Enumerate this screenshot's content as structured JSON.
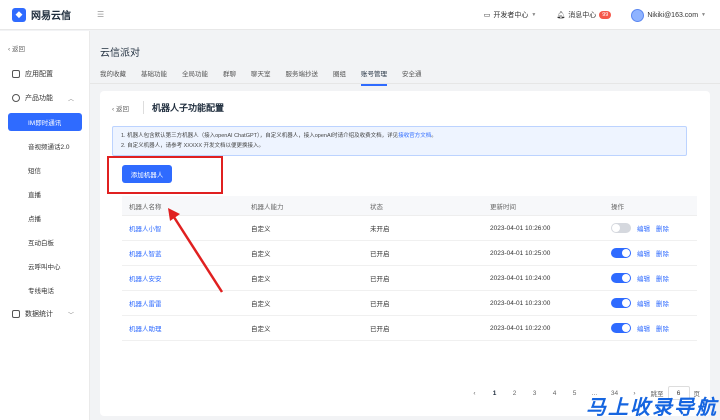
{
  "app": {
    "logo_text": "网易云信",
    "collapse_icon": "menu-collapse-icon"
  },
  "topbar": {
    "developer_center": "开发者中心",
    "messages": "消息中心",
    "message_badge": "99",
    "user_email": "Nikiki@163.com"
  },
  "sidebar": {
    "back": "返回",
    "items": [
      {
        "label": "应用配置",
        "icon": "app-settings-icon"
      },
      {
        "label": "产品功能",
        "icon": "product-icon"
      }
    ],
    "sub_items": [
      "IM即时通讯",
      "音视频通话2.0",
      "短信",
      "直播",
      "点播",
      "互动白板",
      "云呼叫中心",
      "专线电话"
    ],
    "stats": {
      "label": "数据统计",
      "icon": "monitor-icon"
    }
  },
  "main": {
    "title": "云信派对",
    "tabs": [
      "我的收藏",
      "基础功能",
      "全局功能",
      "群聊",
      "聊天室",
      "服务端抄送",
      "圈组",
      "账号管理",
      "安全通"
    ],
    "active_tab": "账号管理"
  },
  "card": {
    "back": "返回",
    "title": "机器人子功能配置",
    "notice_line1": "1. 机器人包含默认第三方机器人（接入openAI ChatGPT），自定义机器人，接入openAI时请介绍及收费文档，详见",
    "notice_link": "接收官方文档",
    "notice_line2": "2. 自定义机器人，请参考 XXXXX 开发文档以便更换接入。",
    "add_button": "添加机器人"
  },
  "table": {
    "headers": [
      "机器人名称",
      "机器人能力",
      "状态",
      "更新时间",
      "操作"
    ],
    "rows": [
      {
        "name": "机器人小智",
        "ability": "自定义",
        "status": "未开启",
        "time": "2023-04-01 10:26:00",
        "on": false
      },
      {
        "name": "机器人智蓝",
        "ability": "自定义",
        "status": "已开启",
        "time": "2023-04-01 10:25:00",
        "on": true
      },
      {
        "name": "机器人安安",
        "ability": "自定义",
        "status": "已开启",
        "time": "2023-04-01 10:24:00",
        "on": true
      },
      {
        "name": "机器人雷雷",
        "ability": "自定义",
        "status": "已开启",
        "time": "2023-04-01 10:23:00",
        "on": true
      },
      {
        "name": "机器人助理",
        "ability": "自定义",
        "status": "已开启",
        "time": "2023-04-01 10:22:00",
        "on": true
      }
    ],
    "edit_label": "编辑",
    "delete_label": "删除"
  },
  "pager": {
    "pages": [
      "1",
      "2",
      "3",
      "4",
      "5",
      "...",
      "34"
    ],
    "active": "1",
    "goto_label": "跳至",
    "goto_value": "6",
    "page_suffix": "页"
  },
  "watermark": "马上收录导航",
  "colors": {
    "accent": "#2f6bff",
    "highlight": "#e02020",
    "badge": "#f5574a"
  }
}
